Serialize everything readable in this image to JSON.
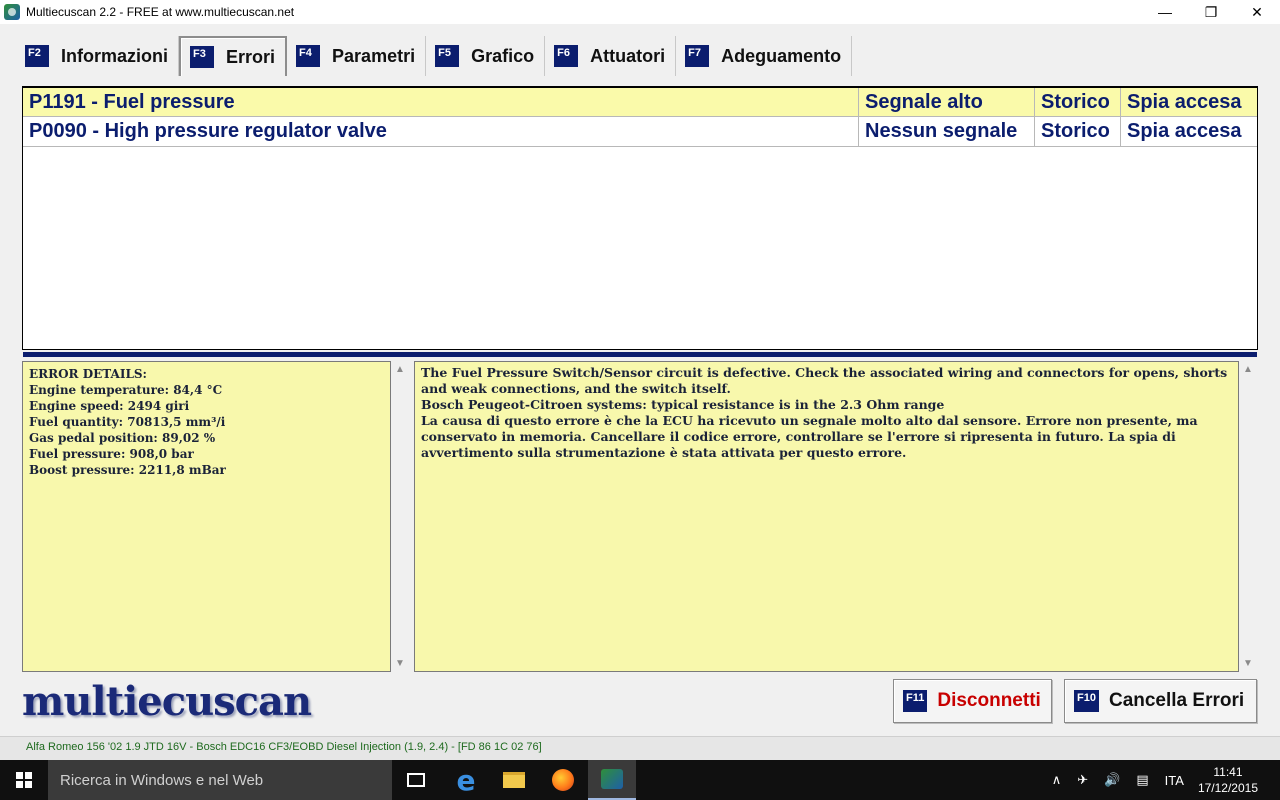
{
  "window": {
    "title": "Multiecuscan 2.2 - FREE at www.multiecuscan.net",
    "minimize_icon": "—",
    "maximize_icon": "❐",
    "close_icon": "✕"
  },
  "tabs": [
    {
      "fkey": "F2",
      "label": "Informazioni"
    },
    {
      "fkey": "F3",
      "label": "Errori"
    },
    {
      "fkey": "F4",
      "label": "Parametri"
    },
    {
      "fkey": "F5",
      "label": "Grafico"
    },
    {
      "fkey": "F6",
      "label": "Attuatori"
    },
    {
      "fkey": "F7",
      "label": "Adeguamento"
    }
  ],
  "errors": [
    {
      "code": "P1191 - Fuel pressure",
      "signal": "Segnale alto",
      "history": "Storico",
      "lamp": "Spia accesa"
    },
    {
      "code": "P0090 - High pressure regulator valve",
      "signal": "Nessun segnale",
      "history": "Storico",
      "lamp": "Spia accesa"
    }
  ],
  "details": {
    "lines": [
      "ERROR DETAILS:",
      "Engine temperature: 84,4 °C",
      "Engine speed: 2494 giri",
      "Fuel quantity: 70813,5 mm³/i",
      "Gas pedal position: 89,02 %",
      "Fuel pressure: 908,0 bar",
      "Boost pressure: 2211,8 mBar"
    ]
  },
  "description": {
    "paragraphs": [
      "The Fuel Pressure Switch/Sensor circuit is defective. Check the associated wiring and connectors for opens, shorts and weak connections, and the switch itself.",
      "Bosch Peugeot-Citroen systems: typical resistance is in the 2.3 Ohm range",
      "La causa di questo errore è che la ECU ha ricevuto un segnale molto alto dal sensore. Errore non presente, ma conservato in memoria. Cancellare il codice errore, controllare se l'errore si ripresenta in futuro. La spia di avvertimento sulla strumentazione è stata attivata per questo errore."
    ]
  },
  "logo": "multiecuscan",
  "buttons": {
    "disconnect": {
      "fkey": "F11",
      "label": "Disconnetti"
    },
    "clear": {
      "fkey": "F10",
      "label": "Cancella Errori"
    }
  },
  "status": "Alfa Romeo 156 '02 1.9 JTD 16V - Bosch EDC16 CF3/EOBD Diesel Injection (1.9, 2.4) - [FD 86 1C 02 76]",
  "taskbar": {
    "search_placeholder": "Ricerca in Windows e nel Web",
    "edge_glyph": "e",
    "language": "ITA",
    "time": "11:41",
    "date": "17/12/2015",
    "tray_chevron": "∧",
    "volume_glyph": "🔊",
    "message_glyph": "▤",
    "network_glyph": "✈"
  },
  "scroll": {
    "up": "▲",
    "down": "▼"
  },
  "colors": {
    "accent_navy": "#0b1d6e",
    "panel_yellow": "#f8f8ac",
    "disconnect_red": "#c80000",
    "status_green": "#1e6a1e"
  }
}
